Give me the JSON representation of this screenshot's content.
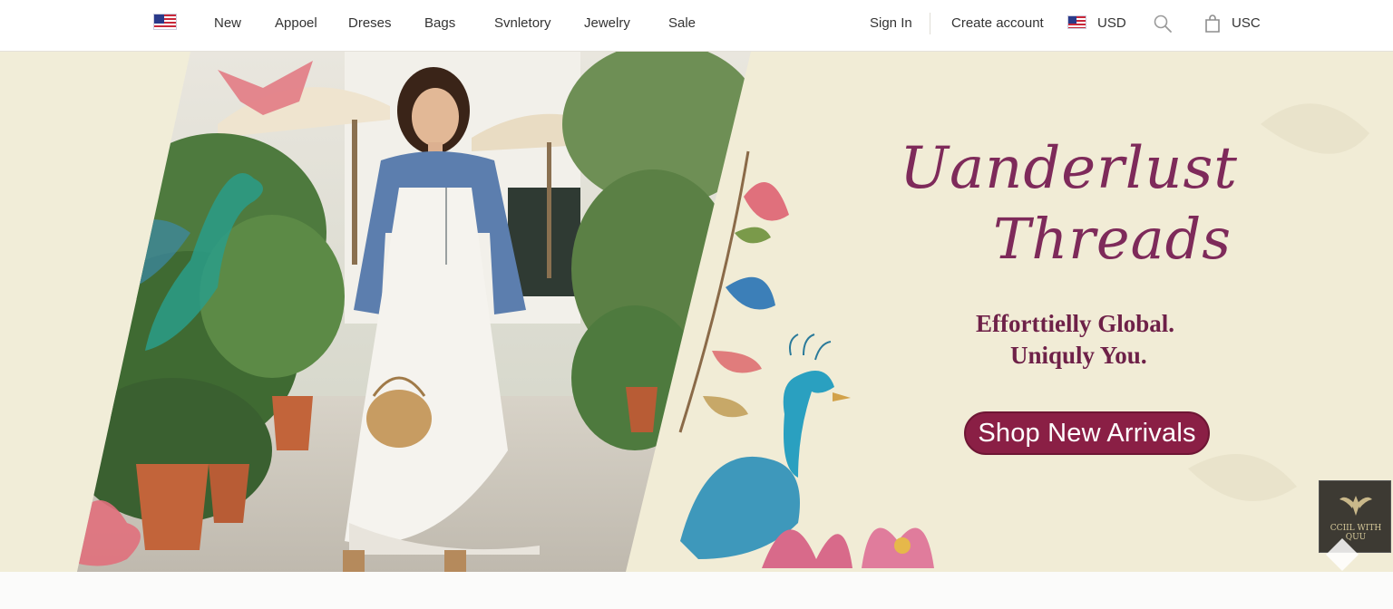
{
  "colors": {
    "brand_accent": "#7e2a5a",
    "cta_background": "#8a1f45",
    "hero_background": "#f1ecd6"
  },
  "header": {
    "flag_icon": "us-flag-icon",
    "nav": [
      "New",
      "Appoel",
      "Dreses",
      "Bags",
      "Svnletory",
      "Jewelry",
      "Sale"
    ],
    "sign_in": "Sign In",
    "create_account": "Create account",
    "currency_flag_icon": "us-flag-icon",
    "currency": "USD",
    "search_icon": "search-icon",
    "bag_icon": "shopping-bag-icon",
    "cart_label": "USC"
  },
  "hero": {
    "title_line1": "Uanderlust",
    "title_line2": "Threads",
    "tagline_line1": "Efforttielly Global.",
    "tagline_line2": "Uniquly You.",
    "cta_label": "Shop New Arrivals"
  },
  "badge": {
    "text": "CCIIL WITH\nQUU",
    "icon": "winged-emblem-icon"
  }
}
